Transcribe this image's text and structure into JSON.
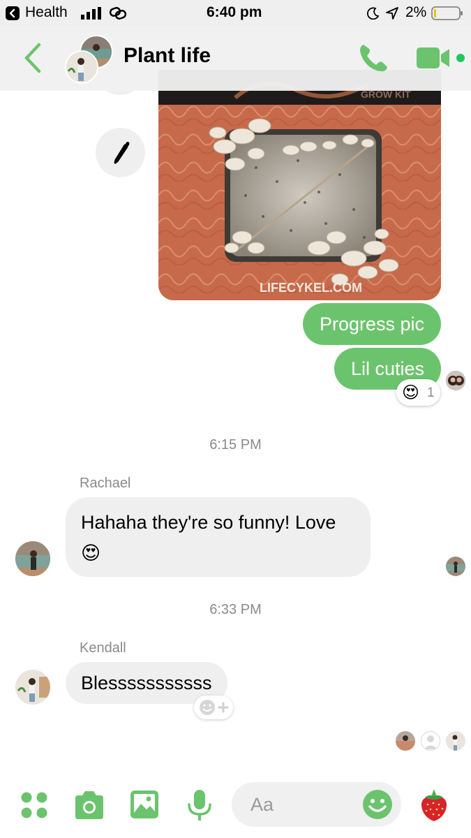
{
  "status_bar": {
    "back_app": "Health",
    "time": "6:40 pm",
    "battery": "2%"
  },
  "header": {
    "title": "Plant life"
  },
  "messages": {
    "out1": "Progress pic",
    "out2": "Lil cuties",
    "reaction_emoji": "😍",
    "reaction_count": "1",
    "photo_caption": "LIFECYKEL.COM",
    "photo_top_text": "GROW KIT",
    "ts1": "6:15 PM",
    "sender1": "Rachael",
    "in1_line1": "Hahaha they're so funny! Love",
    "in1_emoji": "😍",
    "ts2": "6:33 PM",
    "sender2": "Kendall",
    "in2": "Blesssssssssss"
  },
  "composer": {
    "placeholder": "Aa",
    "like_emoji": "🍓"
  },
  "colors": {
    "accent": "#6bc46d",
    "incoming_bubble": "#efefef",
    "photo_board": "#c76a4b"
  },
  "icons": [
    "back-chevron-icon",
    "phone-icon",
    "video-camera-icon",
    "pencil-icon",
    "apps-grid-icon",
    "camera-icon",
    "gallery-icon",
    "microphone-icon",
    "smiley-icon",
    "strawberry-icon",
    "add-reaction-icon"
  ]
}
